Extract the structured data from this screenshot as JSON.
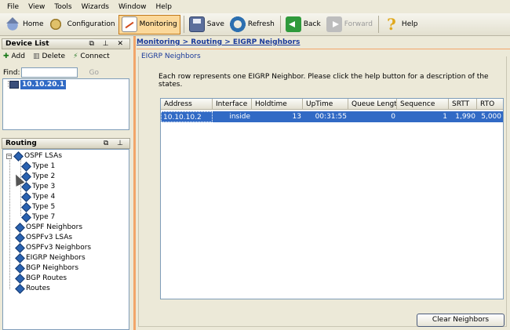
{
  "menu": [
    "File",
    "View",
    "Tools",
    "Wizards",
    "Window",
    "Help"
  ],
  "toolbar": {
    "home": "Home",
    "configuration": "Configuration",
    "monitoring": "Monitoring",
    "save": "Save",
    "refresh": "Refresh",
    "back": "Back",
    "forward": "Forward",
    "help": "Help"
  },
  "device_list": {
    "title": "Device List",
    "add": "Add",
    "delete": "Delete",
    "connect": "Connect",
    "find_label": "Find:",
    "find_value": "",
    "go": "Go",
    "device": "10.10.20.1"
  },
  "routing": {
    "title": "Routing",
    "items": [
      {
        "label": "OSPF LSAs"
      },
      {
        "label": "Type 1"
      },
      {
        "label": "Type 2"
      },
      {
        "label": "Type 3"
      },
      {
        "label": "Type 4"
      },
      {
        "label": "Type 5"
      },
      {
        "label": "Type 7"
      },
      {
        "label": "OSPF Neighbors"
      },
      {
        "label": "OSPFv3 LSAs"
      },
      {
        "label": "OSPFv3 Neighbors"
      },
      {
        "label": "EIGRP Neighbors"
      },
      {
        "label": "BGP Neighbors"
      },
      {
        "label": "BGP Routes"
      },
      {
        "label": "Routes"
      }
    ],
    "selected": "EIGRP Neighbors"
  },
  "main": {
    "breadcrumb": "Monitoring > Routing > EIGRP Neighbors",
    "group_title": "EIGRP Neighbors",
    "description": "Each row represents one EIGRP Neighbor. Please click the help button for a description of the states.",
    "columns": [
      "Address",
      "Interface",
      "Holdtime",
      "UpTime",
      "Queue Length",
      "Sequence",
      "SRTT",
      "RTO"
    ],
    "rows": [
      [
        "10.10.10.2",
        "inside",
        "13",
        "00:31:55",
        "0",
        "1",
        "1,990",
        "5,000"
      ]
    ],
    "clear_button": "Clear Neighbors"
  }
}
